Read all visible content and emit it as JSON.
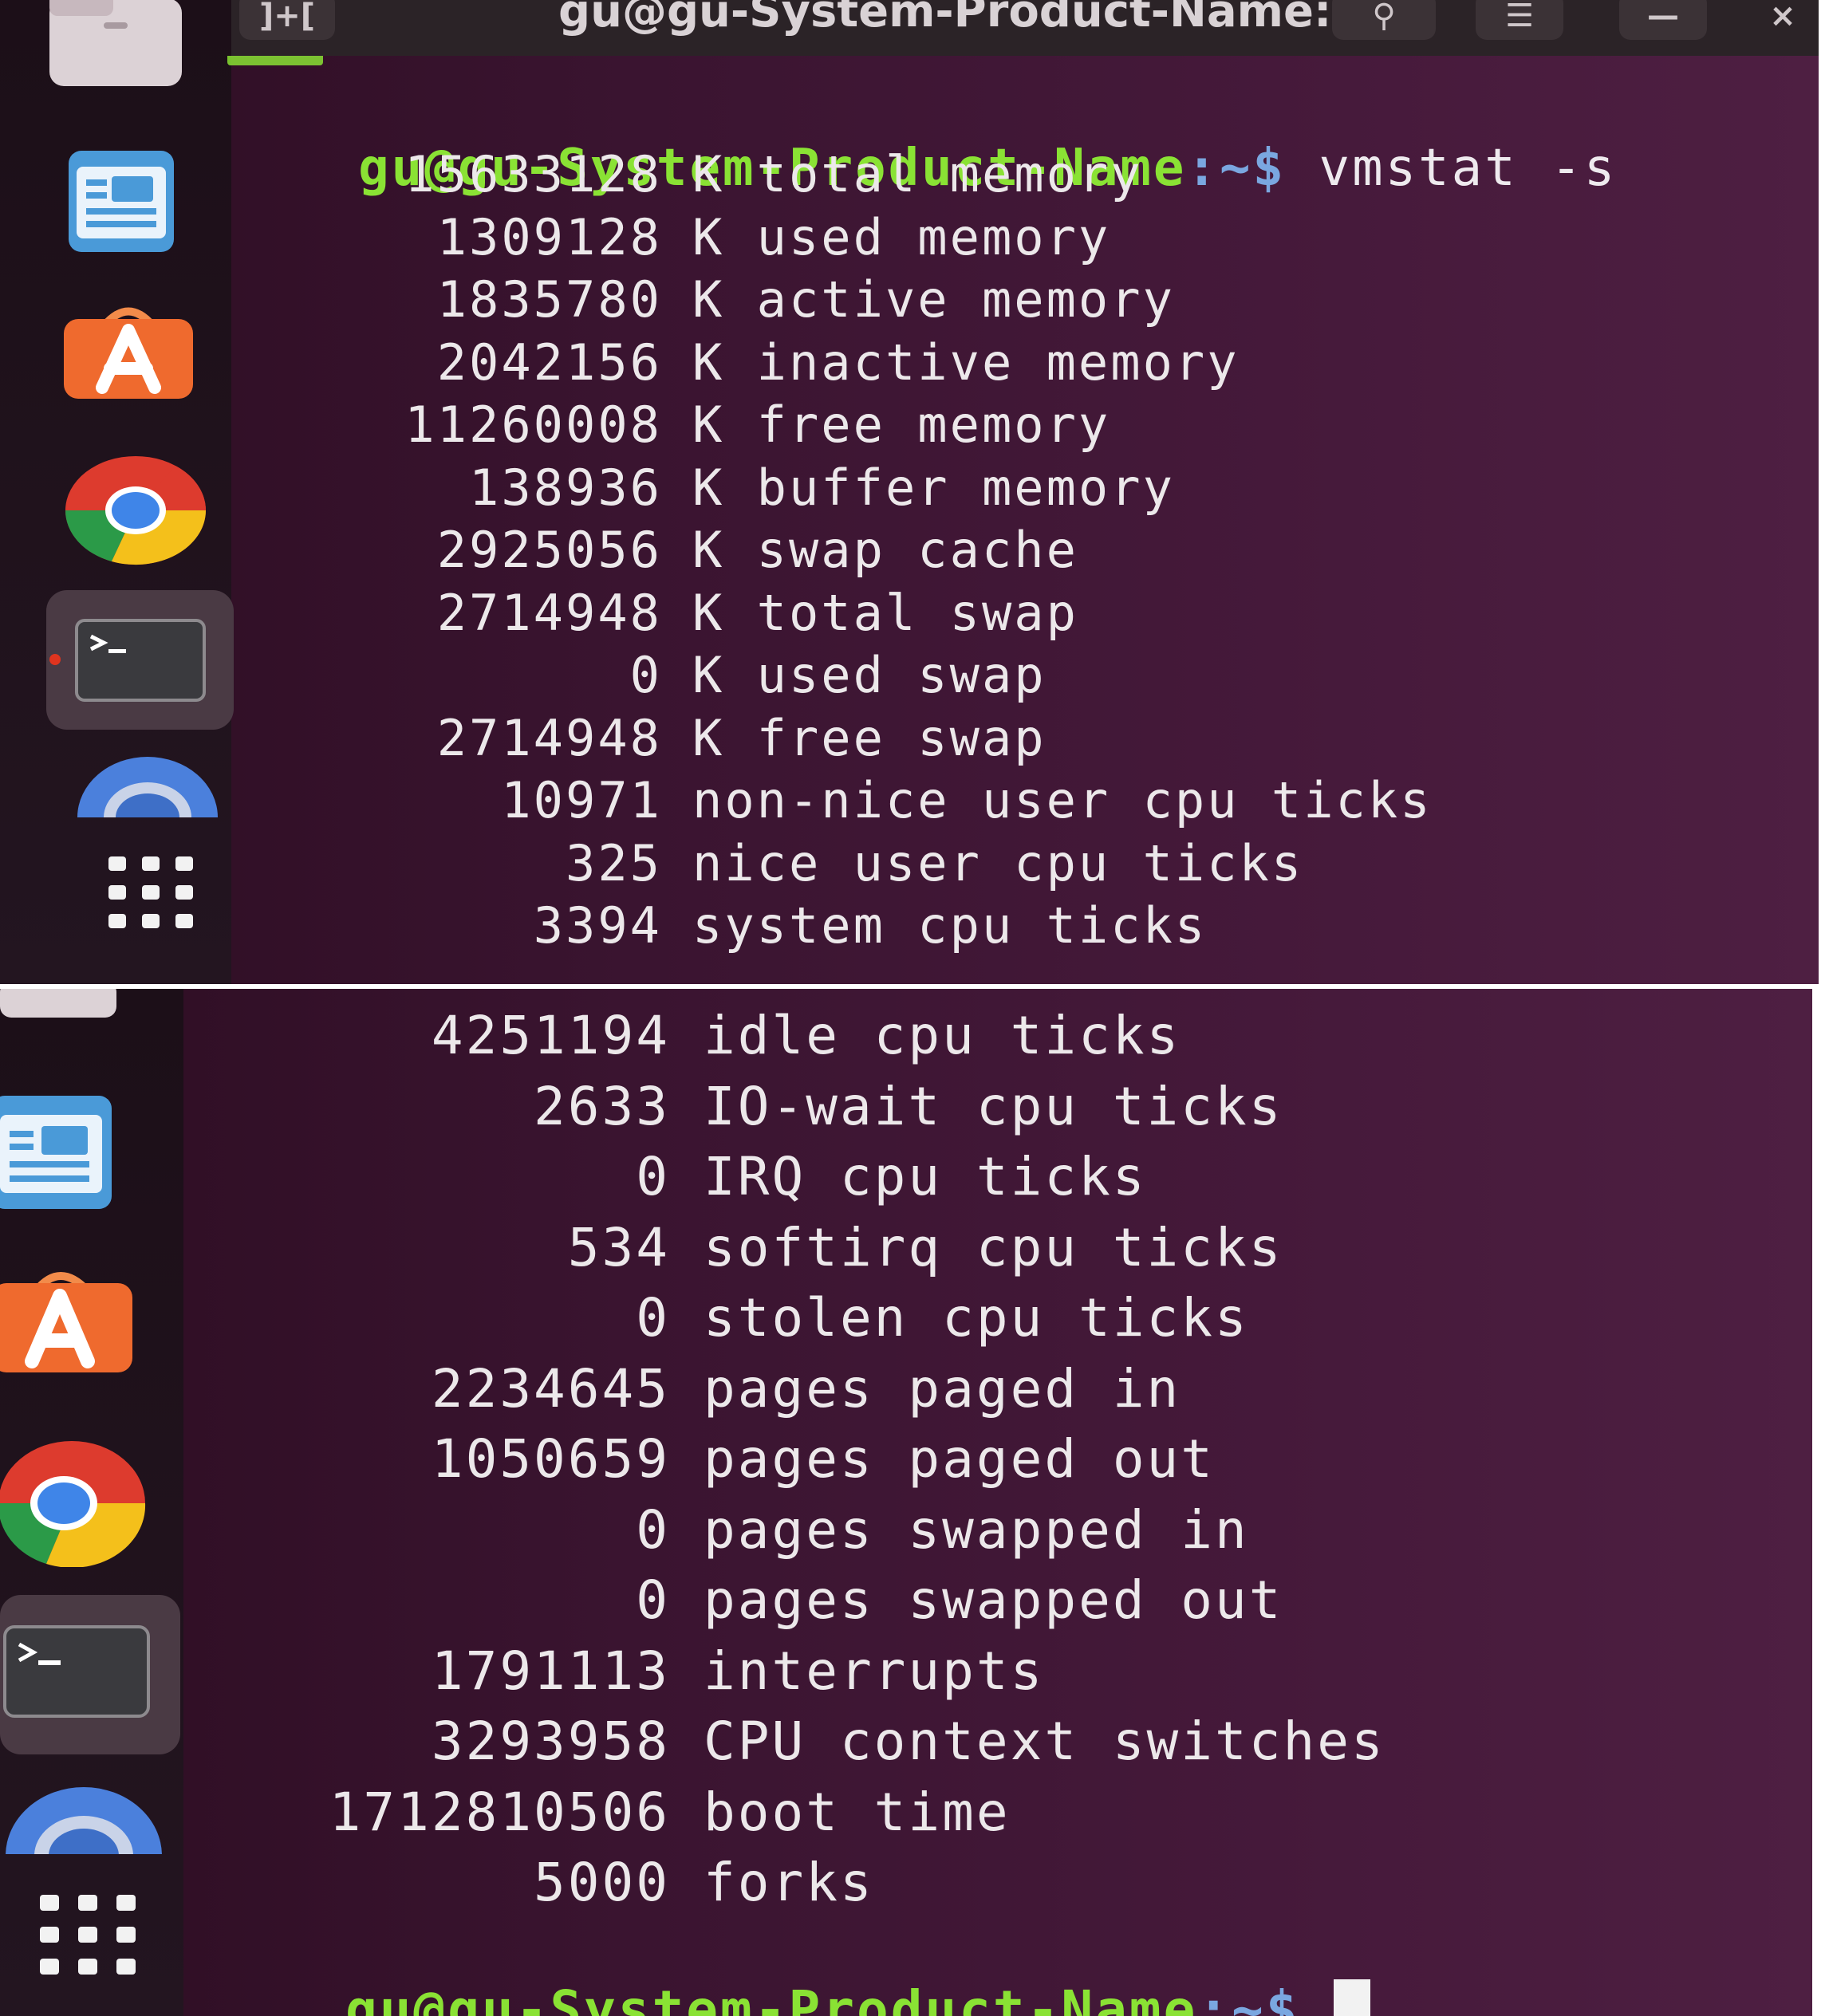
{
  "window": {
    "title": "gu@gu-System-Product-Name: ~",
    "new_tab_icon": "new-tab-icon",
    "search_icon": "search-icon",
    "menu_icon": "hamburger-menu-icon",
    "minimize_icon": "minimize-icon",
    "close_icon": "close-icon"
  },
  "dock": {
    "items": [
      {
        "name": "Files",
        "icon": "folder-icon"
      },
      {
        "name": "LibreOffice Impress",
        "icon": "presentation-icon"
      },
      {
        "name": "Ubuntu Software",
        "icon": "software-store-icon"
      },
      {
        "name": "Google Chrome",
        "icon": "chrome-icon"
      },
      {
        "name": "Terminal",
        "icon": "terminal-icon"
      },
      {
        "name": "Chrome Remote",
        "icon": "chrome-partial-icon"
      },
      {
        "name": "Show Applications",
        "icon": "app-grid-icon"
      }
    ]
  },
  "terminal": {
    "prompt_user": "gu@gu-System-Product-Name",
    "prompt_path": ":~$",
    "command": " vmstat -s",
    "top_lines": [
      {
        "value": "15633128",
        "label": "K total memory"
      },
      {
        "value": "1309128",
        "label": "K used memory"
      },
      {
        "value": "1835780",
        "label": "K active memory"
      },
      {
        "value": "2042156",
        "label": "K inactive memory"
      },
      {
        "value": "11260008",
        "label": "K free memory"
      },
      {
        "value": "138936",
        "label": "K buffer memory"
      },
      {
        "value": "2925056",
        "label": "K swap cache"
      },
      {
        "value": "2714948",
        "label": "K total swap"
      },
      {
        "value": "0",
        "label": "K used swap"
      },
      {
        "value": "2714948",
        "label": "K free swap"
      },
      {
        "value": "10971",
        "label": "non-nice user cpu ticks"
      },
      {
        "value": "325",
        "label": "nice user cpu ticks"
      },
      {
        "value": "3394",
        "label": "system cpu ticks"
      }
    ],
    "bottom_lines": [
      {
        "value": "4251194",
        "label": "idle cpu ticks"
      },
      {
        "value": "2633",
        "label": "IO-wait cpu ticks"
      },
      {
        "value": "0",
        "label": "IRQ cpu ticks"
      },
      {
        "value": "534",
        "label": "softirq cpu ticks"
      },
      {
        "value": "0",
        "label": "stolen cpu ticks"
      },
      {
        "value": "2234645",
        "label": "pages paged in"
      },
      {
        "value": "1050659",
        "label": "pages paged out"
      },
      {
        "value": "0",
        "label": "pages swapped in"
      },
      {
        "value": "0",
        "label": "pages swapped out"
      },
      {
        "value": "1791113",
        "label": "interrupts"
      },
      {
        "value": "3293958",
        "label": "CPU context switches"
      },
      {
        "value": "1712810506",
        "label": "boot time"
      },
      {
        "value": "5000",
        "label": "forks"
      }
    ],
    "final_prompt_user": "gu@gu-System-Product-Name",
    "final_prompt_path": ":~$"
  }
}
